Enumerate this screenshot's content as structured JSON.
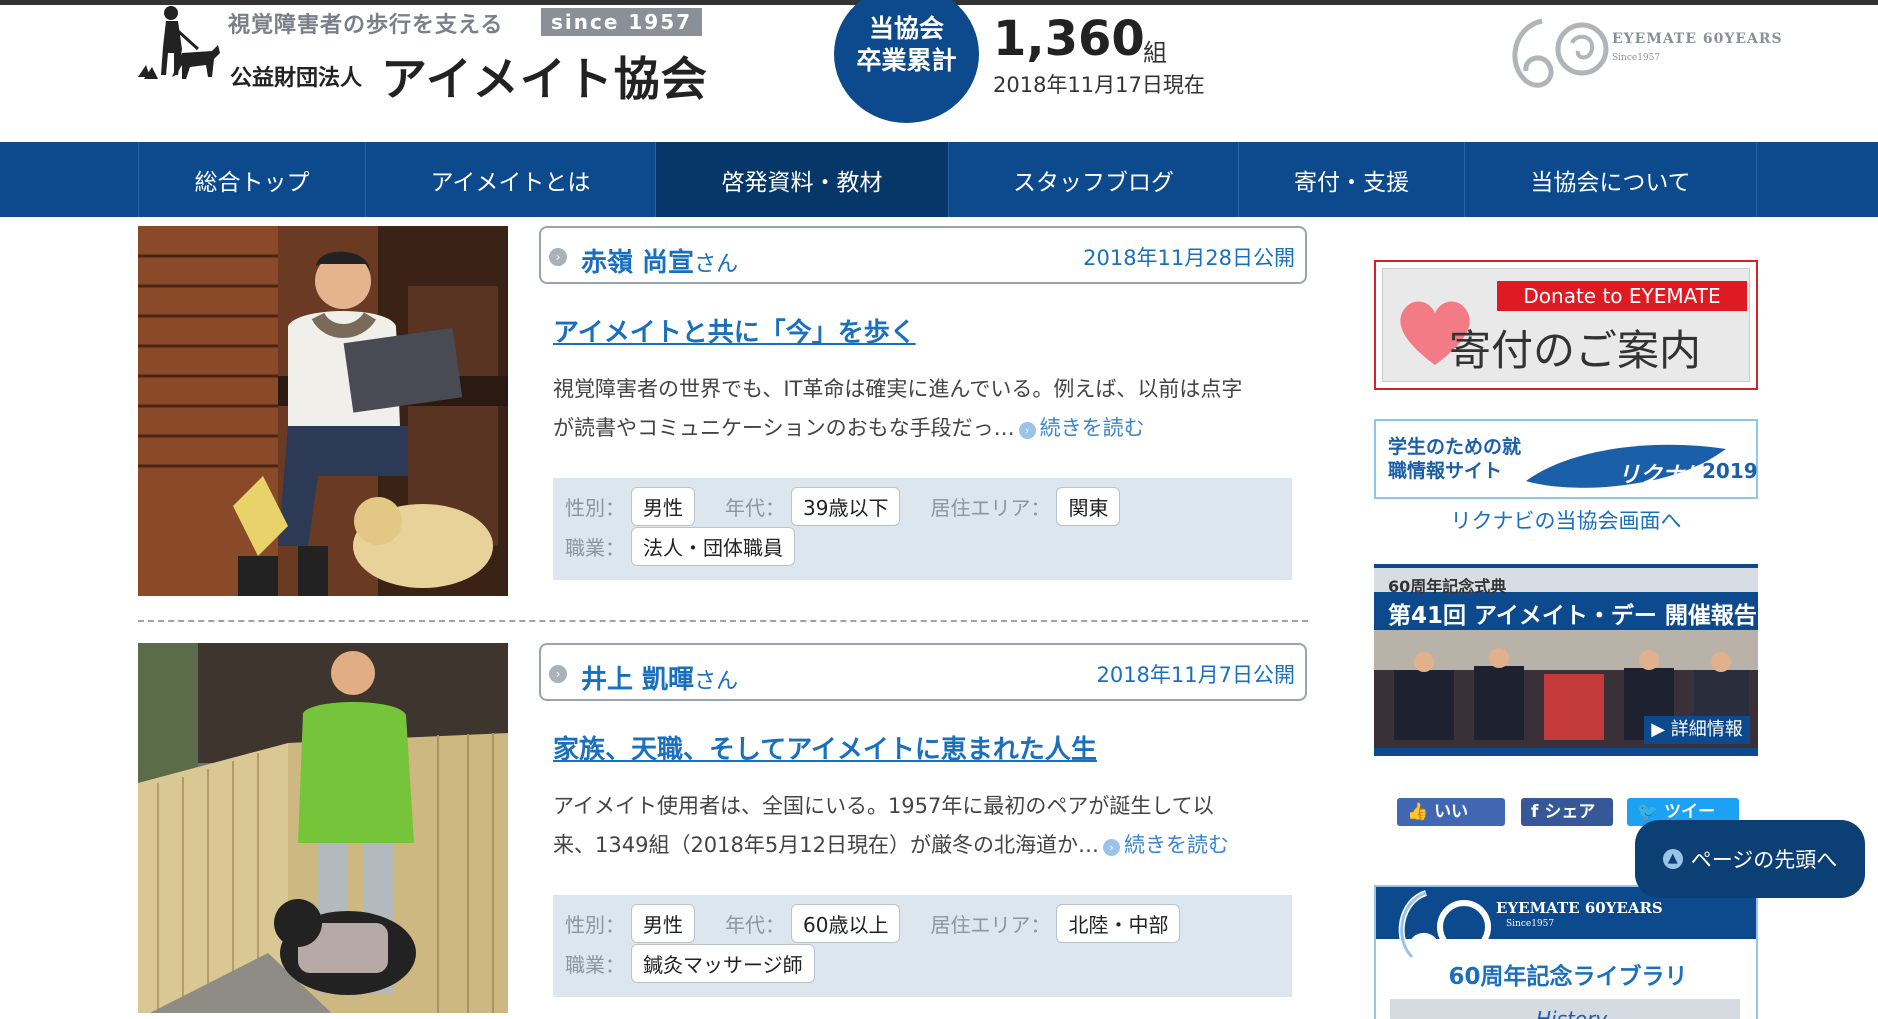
{
  "header": {
    "tagline": "視覚障害者の歩行を支える",
    "since_badge": "since 1957",
    "org_type": "公益財団法人",
    "org_name": "アイメイト協会",
    "graduates": {
      "circle_line1": "当協会",
      "circle_line2": "卒業累計",
      "count": "1,360",
      "unit": "組",
      "as_of": "2018年11月17日現在"
    },
    "anniversary_logo": {
      "title": "EYEMATE 60YEARS",
      "since": "Since1957"
    }
  },
  "nav": {
    "items": [
      {
        "label": "総合トップ"
      },
      {
        "label": "アイメイトとは"
      },
      {
        "label": "啓発資料・教材"
      },
      {
        "label": "スタッフブログ"
      },
      {
        "label": "寄付・支援"
      },
      {
        "label": "当協会について"
      }
    ],
    "active_index": 2
  },
  "articles": [
    {
      "name": "赤嶺 尚宣",
      "honorific": "さん",
      "date": "2018年11月28日公開",
      "title": "アイメイトと共に「今」を歩く",
      "excerpt_line1": "視覚障害者の世界でも、IT革命は確実に進んでいる。例えば、以前は点字",
      "excerpt_line2": "が読書やコミュニケーションのおもな手段だっ…",
      "read_more": "続きを読む",
      "tags": {
        "gender_label": "性別：",
        "gender": "男性",
        "age_label": "年代：",
        "age": "39歳以下",
        "area_label": "居住エリア：",
        "area": "関東",
        "job_label": "職業：",
        "job": "法人・団体職員"
      }
    },
    {
      "name": "井上 凱暉",
      "honorific": "さん",
      "date": "2018年11月7日公開",
      "title": "家族、天職、そしてアイメイトに恵まれた人生",
      "excerpt_line1": "アイメイト使用者は、全国にいる。1957年に最初のペアが誕生して以",
      "excerpt_line2": "来、1349組（2018年5月12日現在）が厳冬の北海道か…",
      "read_more": "続きを読む",
      "tags": {
        "gender_label": "性別：",
        "gender": "男性",
        "age_label": "年代：",
        "age": "60歳以上",
        "area_label": "居住エリア：",
        "area": "北陸・中部",
        "job_label": "職業：",
        "job": "鍼灸マッサージ師"
      }
    }
  ],
  "sidebar": {
    "donate": {
      "top": "Donate to EYEMATE",
      "main": "寄付のご案内"
    },
    "rikunabi": {
      "text": "学生のための就職情報サイト",
      "logo": "リクナビ",
      "year": "2019",
      "link": "リクナビの当協会画面へ"
    },
    "event": {
      "subtitle": "60周年記念式典",
      "title": "第41回 アイメイト・デー 開催報告",
      "button": "▶ 詳細情報"
    },
    "share": {
      "like": "いいね！",
      "share": "シェア",
      "tweet": "ツイート"
    },
    "anniversary_library": {
      "title": "EYEMATE 60YEARS",
      "since": "Since1957",
      "label": "60周年記念ライブラリ",
      "history": "History"
    }
  },
  "to_top": "ページの先頭へ",
  "colors": {
    "brand_blue": "#0c4a8d",
    "link_blue": "#1a6fbf",
    "donate_red": "#e01a22"
  }
}
